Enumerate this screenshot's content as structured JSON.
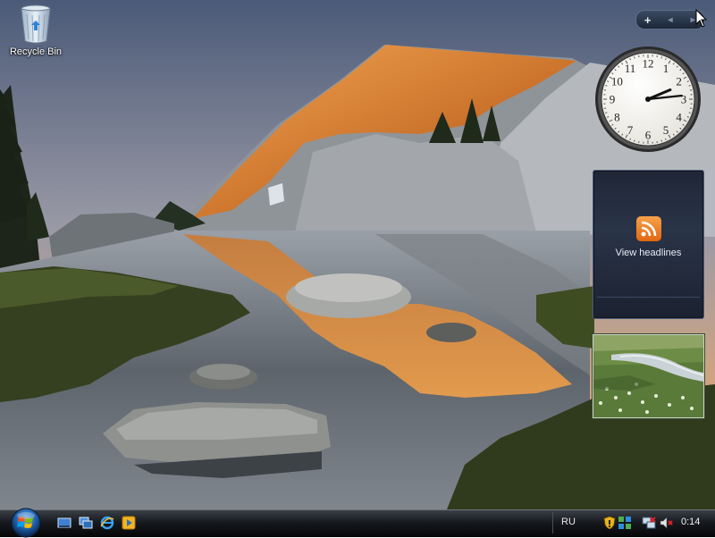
{
  "desktop": {
    "recycle_bin_label": "Recycle Bin"
  },
  "sidebar": {
    "add_gadget_glyph": "+",
    "prev_glyph": "◂",
    "next_glyph": "▸",
    "clock": {
      "hour": 2,
      "minute": 14,
      "second": 0
    },
    "feed_gadget": {
      "label": "View headlines",
      "icon": "rss-feed-icon"
    },
    "slideshow_gadget": {
      "icon": "stream-meadow-photo"
    }
  },
  "taskbar": {
    "start_icon": "windows-orb-icon",
    "quick_launch": [
      "show-desktop-icon",
      "switch-windows-icon",
      "internet-explorer-icon",
      "media-player-icon"
    ],
    "language": "RU",
    "tray_icons": [
      "security-shield-icon",
      "sync-icon",
      "network-disconnected-icon",
      "volume-muted-icon"
    ],
    "time": "0:14"
  },
  "colors": {
    "taskbar": "#16191e",
    "rss_orange": "#f08a2a",
    "feed_bg": "#242d40"
  }
}
